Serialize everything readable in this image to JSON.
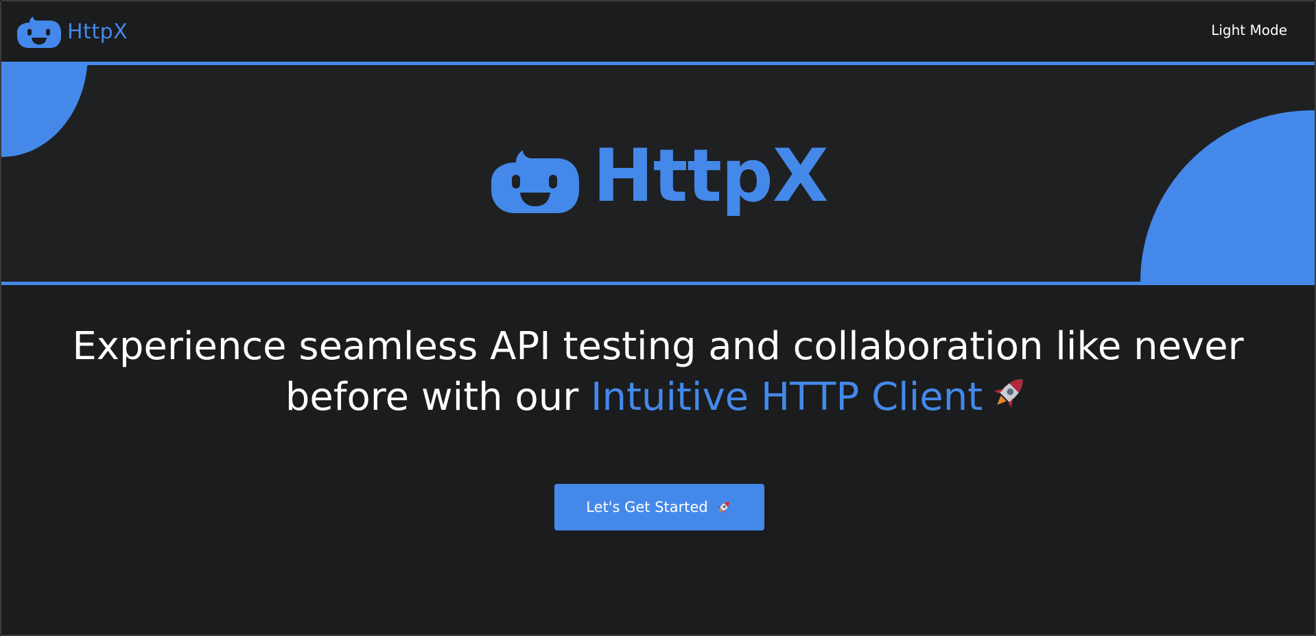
{
  "navbar": {
    "brand_name": "HttpX",
    "mode_toggle_label": "Light Mode"
  },
  "hero": {
    "title": "HttpX"
  },
  "tagline": {
    "text_main": "Experience seamless API testing and collaboration like never before with our ",
    "text_accent": "Intuitive HTTP Client",
    "icon": "rocket-icon"
  },
  "cta": {
    "label": "Let's Get Started",
    "icon": "rocket-icon"
  },
  "colors": {
    "accent": "#4489ea",
    "background": "#1b1c1e",
    "hero_background": "#1f2022",
    "text": "#ffffff"
  }
}
